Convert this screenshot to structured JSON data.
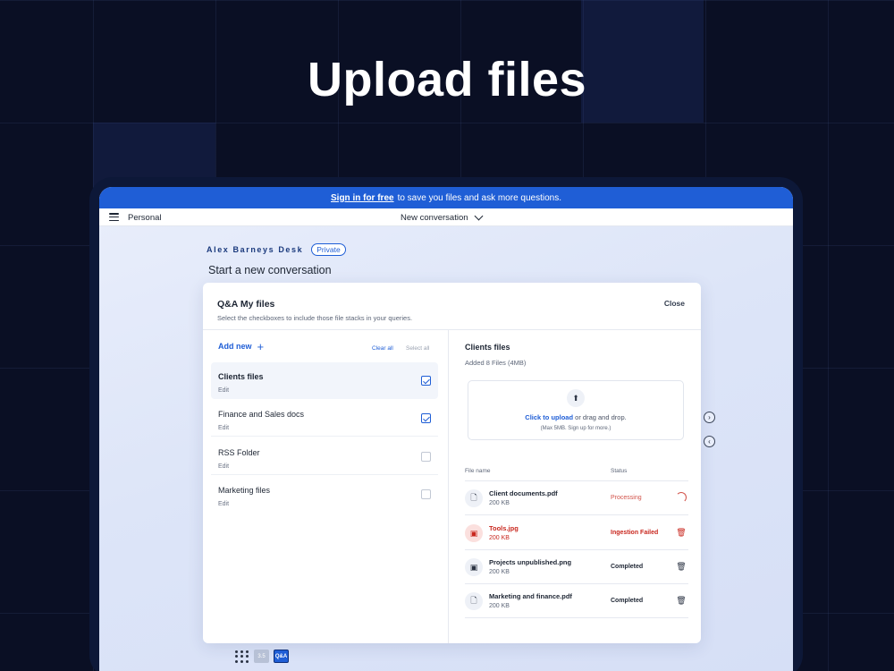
{
  "hero": {
    "title": "Upload files"
  },
  "banner": {
    "link_text": "Sign in for free",
    "text": "to save you files and ask more questions."
  },
  "topbar": {
    "workspace": "Personal",
    "conversation": "New conversation"
  },
  "desk": {
    "name": "Alex Barneys Desk",
    "badge": "Private",
    "heading": "Start a new conversation"
  },
  "modal": {
    "title": "Q&A My files",
    "subtitle": "Select the checkboxes to include those file stacks in your queries.",
    "close_label": "Close",
    "add_new_label": "Add new",
    "clear_all_label": "Clear all",
    "select_all_label": "Select all",
    "folders": [
      {
        "name": "Clients files",
        "edit": "Edit",
        "checked": true,
        "active": true
      },
      {
        "name": "Finance and Sales docs",
        "edit": "Edit",
        "checked": true,
        "active": false
      },
      {
        "name": "RSS Folder",
        "edit": "Edit",
        "checked": false,
        "active": false
      },
      {
        "name": "Marketing files",
        "edit": "Edit",
        "checked": false,
        "active": false
      }
    ],
    "detail": {
      "title": "Clients files",
      "added": "Added 8 Files (4MB)",
      "upload_link": "Click to upload",
      "upload_text": "or drag and drop.",
      "upload_hint": "(Max 5MB. Sign up for more.)",
      "col_name": "File name",
      "col_status": "Status",
      "files": [
        {
          "name": "Client documents.pdf",
          "size": "200 KB",
          "status": "Processing",
          "icon": "document-icon",
          "state": "processing"
        },
        {
          "name": "Tools.jpg",
          "size": "200 KB",
          "status": "Ingestion Failed",
          "icon": "image-icon",
          "state": "failed"
        },
        {
          "name": "Projects unpublished.png",
          "size": "200 KB",
          "status": "Completed",
          "icon": "image-icon",
          "state": "completed"
        },
        {
          "name": "Marketing and finance.pdf",
          "size": "200 KB",
          "status": "Completed",
          "icon": "document-icon",
          "state": "completed"
        }
      ]
    }
  },
  "dock": {
    "version_label": "3.5",
    "qa_label": "Q&A"
  },
  "colors": {
    "accent": "#1f5ed6",
    "error": "#c9281f",
    "background": "#0a0f24"
  }
}
